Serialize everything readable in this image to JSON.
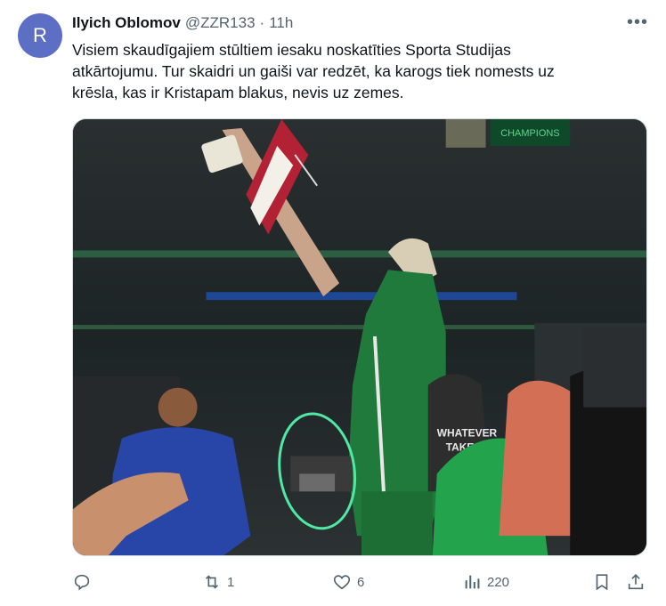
{
  "tweet": {
    "avatar_letter": "R",
    "author": {
      "display_name": "Ilyich Oblomov",
      "handle": "@ZZR133",
      "separator": "·",
      "time": "11h"
    },
    "more_label": "•••",
    "text_lines": [
      "Visiem skaudīgajiem stūltiem iesaku noskatīties Sporta Studijas",
      "atkārtojumu. Tur skaidri un gaiši var redzēt, ka karogs tiek nomests uz",
      "krēsla, kas ir Kristapam blakus, nevis uz zemes."
    ],
    "media": {
      "jumbotron_text": "CHAMPIONS",
      "shirt_text_1": "WHATEVER",
      "shirt_text_2": "TAKES"
    },
    "actions": {
      "reply_icon": "reply-icon",
      "retweet_icon": "retweet-icon",
      "retweet_count": "1",
      "like_icon": "heart-icon",
      "like_count": "6",
      "views_icon": "views-bar-chart-icon",
      "views_count": "220",
      "bookmark_icon": "bookmark-icon",
      "share_icon": "share-icon"
    },
    "colors": {
      "avatar": "#5d6fc4",
      "secondary_text": "#536471",
      "highlight_circle": "#4fe8a4",
      "celtics_green": "#1f7a3b",
      "flag_red": "#b32234"
    }
  }
}
